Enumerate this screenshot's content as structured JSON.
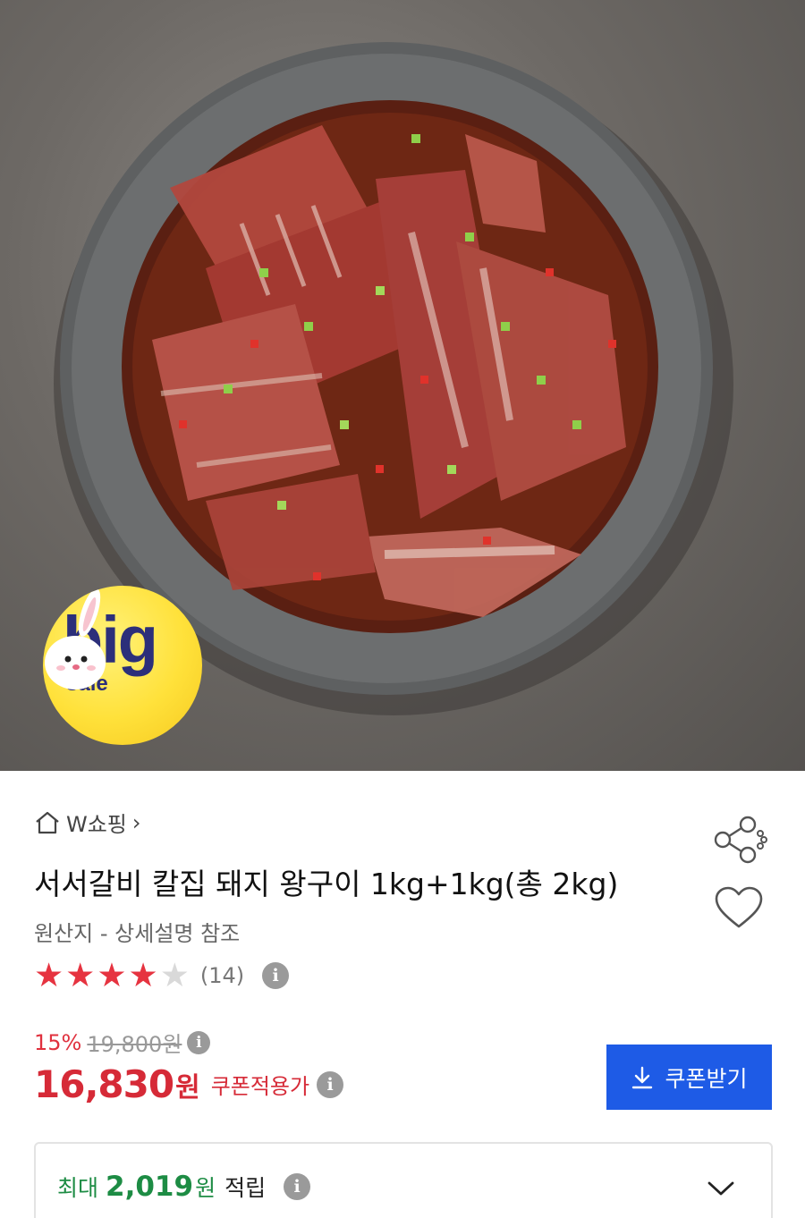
{
  "hero": {
    "image": "marinated-pork-galbi-plate",
    "badge": {
      "big": "big",
      "sale": "sale"
    }
  },
  "breadcrumb": {
    "icon": "home-icon",
    "label": "W쇼핑",
    "chevron": "›"
  },
  "product": {
    "title": "서서갈비 칼집 돼지 왕구이 1kg+1kg(총 2kg)",
    "origin": "원산지 - 상세설명 참조",
    "rating": {
      "stars": 4,
      "max": 5,
      "count_label": "(14)"
    }
  },
  "pricing": {
    "discount": "15%",
    "original_price": "19,800원",
    "price": "16,830",
    "price_unit": "원",
    "coupon_price_label": "쿠폰적용가",
    "coupon_button": "쿠폰받기"
  },
  "points": {
    "prefix": "최대",
    "amount": "2,019",
    "unit": "원",
    "suffix": "적립"
  },
  "colors": {
    "accent_red": "#d62a37",
    "coupon_blue": "#1e5be6",
    "points_green": "#1d8c44",
    "badge_yellow": "#ffe13a"
  },
  "icons": {
    "info": "i",
    "share": "share-icon",
    "heart": "heart-icon",
    "download": "download-icon",
    "expand": "chevron-down-icon"
  }
}
